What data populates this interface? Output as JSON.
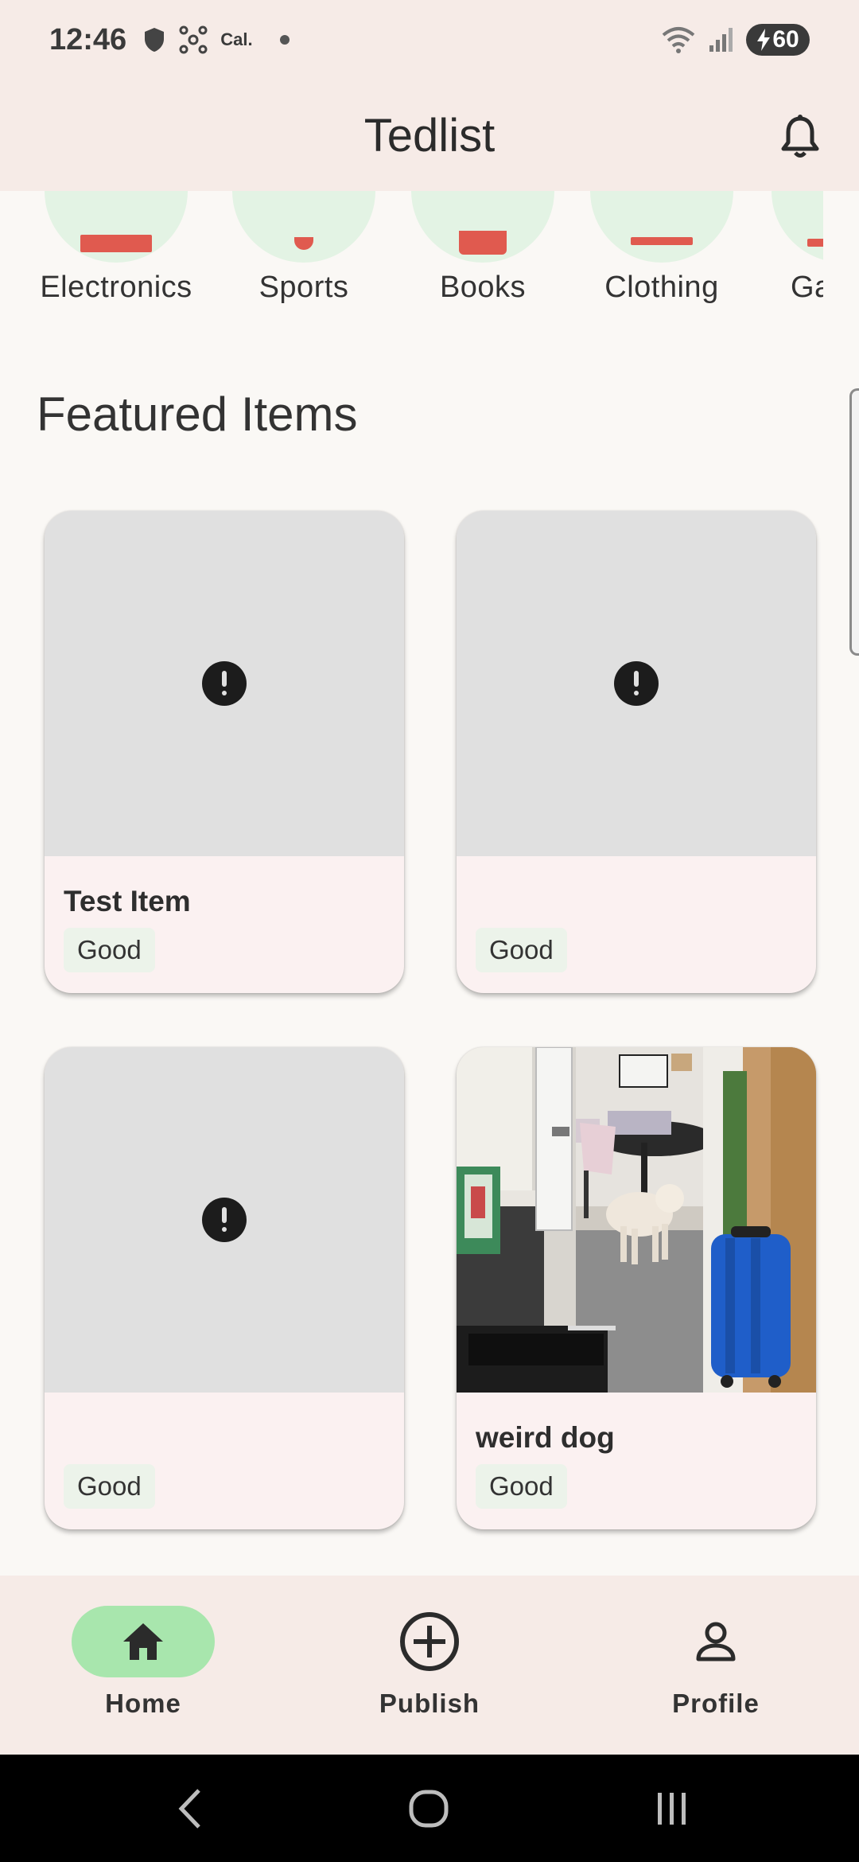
{
  "status_bar": {
    "time": "12:46",
    "carrier": "Cal.",
    "battery": "60"
  },
  "app_bar": {
    "title": "Tedlist"
  },
  "categories": [
    {
      "label": "Electronics"
    },
    {
      "label": "Sports"
    },
    {
      "label": "Books"
    },
    {
      "label": "Clothing"
    },
    {
      "label": "Ga"
    }
  ],
  "featured": {
    "title": "Featured Items",
    "items": [
      {
        "title": "Test Item",
        "condition": "Good",
        "image": "error-icon"
      },
      {
        "title": "",
        "condition": "Good",
        "image": "error-icon"
      },
      {
        "title": "",
        "condition": "Good",
        "image": "error-icon"
      },
      {
        "title": "weird dog",
        "condition": "Good",
        "image": "photo"
      }
    ]
  },
  "bottom_nav": {
    "items": [
      {
        "label": "Home",
        "icon": "home-icon",
        "active": true
      },
      {
        "label": "Publish",
        "icon": "add-circle-icon",
        "active": false
      },
      {
        "label": "Profile",
        "icon": "person-icon",
        "active": false
      }
    ]
  },
  "colors": {
    "accent": "#e05a4f",
    "active_pill": "#a8e6ad",
    "bar_bg": "#f6ebe7"
  }
}
